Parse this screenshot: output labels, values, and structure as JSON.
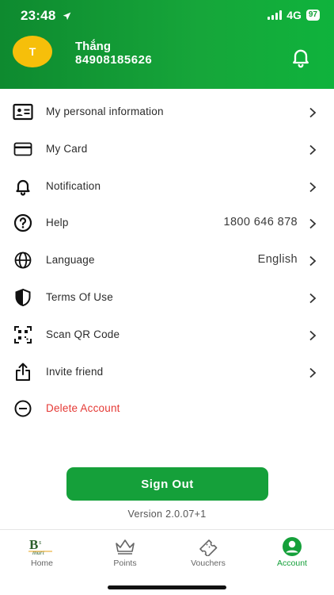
{
  "status_bar": {
    "time": "23:48",
    "network": "4G",
    "battery": "97"
  },
  "header": {
    "avatar_initial": "T",
    "name": "Thắng",
    "phone": "84908185626"
  },
  "menu": [
    {
      "label": "My personal information",
      "value": "",
      "icon": "id-card-icon"
    },
    {
      "label": "My Card",
      "value": "",
      "icon": "card-icon"
    },
    {
      "label": "Notification",
      "value": "",
      "icon": "bell-icon"
    },
    {
      "label": "Help",
      "value": "1800 646 878",
      "icon": "help-icon"
    },
    {
      "label": "Language",
      "value": "English",
      "icon": "globe-icon"
    },
    {
      "label": "Terms Of Use",
      "value": "",
      "icon": "shield-icon"
    },
    {
      "label": "Scan QR Code",
      "value": "",
      "icon": "qr-code-icon"
    },
    {
      "label": "Invite friend",
      "value": "",
      "icon": "share-icon"
    },
    {
      "label": "Delete Account",
      "value": "",
      "icon": "minus-circle-icon"
    }
  ],
  "signout_label": "Sign Out",
  "version": "Version 2.0.07+1",
  "tabs": [
    {
      "label": "Home",
      "icon": "bsmart-logo-icon"
    },
    {
      "label": "Points",
      "icon": "crown-icon"
    },
    {
      "label": "Vouchers",
      "icon": "ticket-icon"
    },
    {
      "label": "Account",
      "icon": "account-icon"
    }
  ],
  "colors": {
    "brand_green": "#15a03a",
    "avatar_yellow": "#f6bf0a",
    "danger_red": "#e53935"
  }
}
